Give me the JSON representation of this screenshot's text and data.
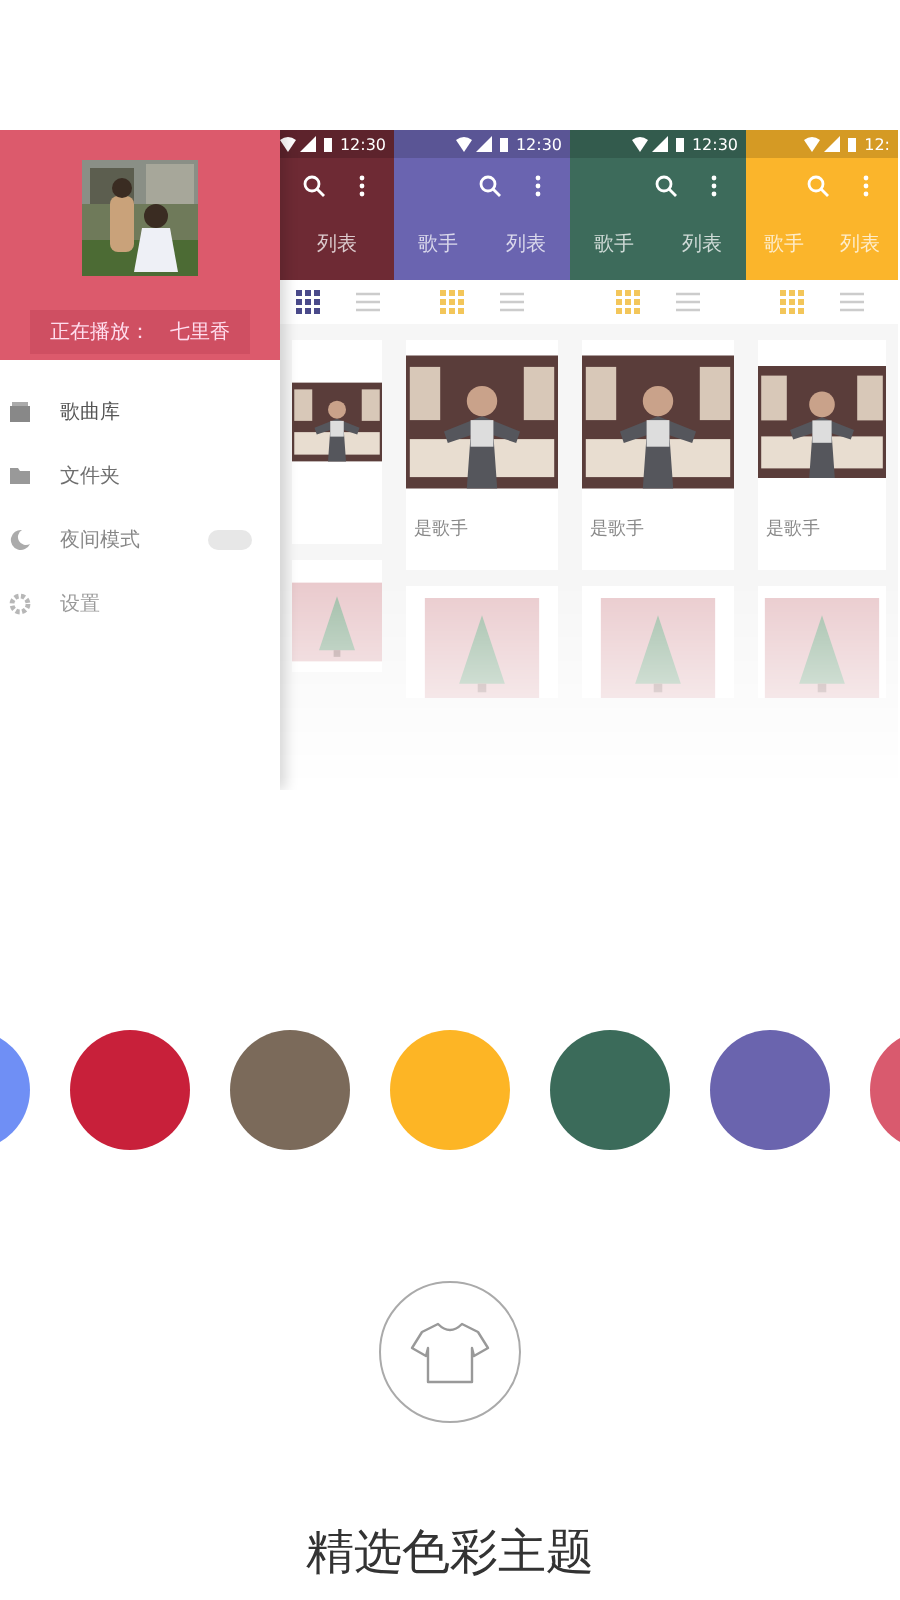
{
  "drawer": {
    "now_playing_label": "正在播放：",
    "now_playing_song": "七里香",
    "items": [
      {
        "kind": "library",
        "label": "歌曲库"
      },
      {
        "kind": "folder",
        "label": "文件夹"
      },
      {
        "kind": "night",
        "label": "夜间模式",
        "on": false
      },
      {
        "kind": "settings",
        "label": "设置"
      }
    ]
  },
  "screens": [
    {
      "color": "#6e2a34",
      "time": "12:30",
      "tabs": [
        "列表"
      ]
    },
    {
      "color": "#6a64b0",
      "time": "12:30",
      "tabs": [
        "歌手",
        "列表"
      ],
      "card_title": "是歌手"
    },
    {
      "color": "#3d6b5b",
      "time": "12:30",
      "tabs": [
        "歌手",
        "列表"
      ],
      "card_title": "是歌手"
    },
    {
      "color": "#fbb52b",
      "time": "12:",
      "tabs": [
        "歌手",
        "列表"
      ],
      "card_title": "是歌手"
    }
  ],
  "swatches": [
    {
      "color": "#6f8ff5"
    },
    {
      "color": "#c8203a"
    },
    {
      "color": "#7b6a5a"
    },
    {
      "color": "#fdb525"
    },
    {
      "color": "#3b6b5a"
    },
    {
      "color": "#6a64ae"
    },
    {
      "color": "#d95a6e"
    }
  ],
  "title": "精选色彩主题"
}
